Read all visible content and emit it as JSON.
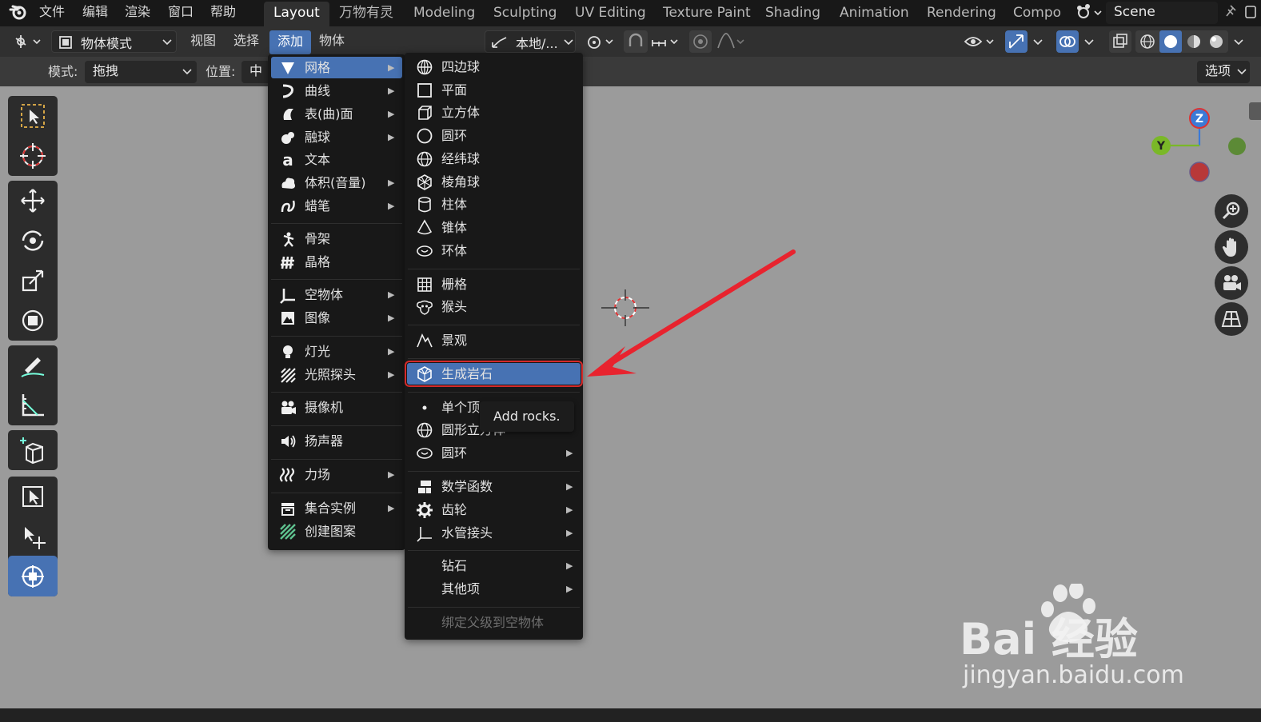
{
  "topbar": {
    "menus": [
      "文件",
      "编辑",
      "渲染",
      "窗口",
      "帮助"
    ],
    "workspaces": [
      "Layout",
      "万物有灵",
      "Modeling",
      "Sculpting",
      "UV Editing",
      "Texture Paint",
      "Shading",
      "Animation",
      "Rendering",
      "Compo"
    ],
    "active_workspace": "Layout",
    "scene": "Scene"
  },
  "header": {
    "mode": "物体模式",
    "menus": [
      "视图",
      "选择",
      "添加",
      "物体"
    ],
    "active_menu": "添加",
    "transform_orientation": "本地/..."
  },
  "toolsettings": {
    "mode_label": "模式:",
    "mode_value": "拖拽",
    "position_label": "位置:",
    "position_value": "中心",
    "options": "选项"
  },
  "add_menu": {
    "items": [
      {
        "label": "网格",
        "icon": "mesh-icon",
        "submenu": true,
        "highlighted": true
      },
      {
        "label": "曲线",
        "icon": "curve-icon",
        "submenu": true
      },
      {
        "label": "表(曲)面",
        "icon": "surface-icon",
        "submenu": true
      },
      {
        "label": "融球",
        "icon": "metaball-icon",
        "submenu": true
      },
      {
        "label": "文本",
        "icon": "text-icon",
        "submenu": false
      },
      {
        "label": "体积(音量)",
        "icon": "volume-icon",
        "submenu": true
      },
      {
        "label": "蜡笔",
        "icon": "grease-pencil-icon",
        "submenu": true
      },
      {
        "label": "骨架",
        "icon": "armature-icon",
        "submenu": false
      },
      {
        "label": "晶格",
        "icon": "lattice-icon",
        "submenu": false
      },
      {
        "label": "空物体",
        "icon": "empty-icon",
        "submenu": true
      },
      {
        "label": "图像",
        "icon": "image-icon",
        "submenu": true
      },
      {
        "label": "灯光",
        "icon": "light-icon",
        "submenu": true
      },
      {
        "label": "光照探头",
        "icon": "light-probe-icon",
        "submenu": true
      },
      {
        "label": "摄像机",
        "icon": "camera-icon",
        "submenu": false
      },
      {
        "label": "扬声器",
        "icon": "speaker-icon",
        "submenu": false
      },
      {
        "label": "力场",
        "icon": "force-field-icon",
        "submenu": true
      },
      {
        "label": "集合实例",
        "icon": "collection-icon",
        "submenu": true
      },
      {
        "label": "创建图案",
        "icon": "pattern-icon",
        "submenu": false
      }
    ]
  },
  "mesh_menu": {
    "items": [
      {
        "label": "四边球",
        "icon": "quad-sphere-icon"
      },
      {
        "label": "平面",
        "icon": "plane-icon"
      },
      {
        "label": "立方体",
        "icon": "cube-icon"
      },
      {
        "label": "圆环",
        "icon": "circle-icon"
      },
      {
        "label": "经纬球",
        "icon": "uv-sphere-icon"
      },
      {
        "label": "棱角球",
        "icon": "ico-sphere-icon"
      },
      {
        "label": "柱体",
        "icon": "cylinder-icon"
      },
      {
        "label": "锥体",
        "icon": "cone-icon"
      },
      {
        "label": "环体",
        "icon": "torus-icon"
      },
      {
        "label": "栅格",
        "icon": "grid-icon"
      },
      {
        "label": "猴头",
        "icon": "monkey-icon"
      },
      {
        "label": "景观",
        "icon": "landscape-icon"
      },
      {
        "label": "生成岩石",
        "icon": "rock-icon",
        "highlighted": true
      },
      {
        "label": "单个顶",
        "icon": "vertex-icon"
      },
      {
        "label": "圆形立方体",
        "icon": "round-cube-icon"
      },
      {
        "label": "圆环",
        "icon": "torus-obj-icon",
        "submenu": true
      },
      {
        "label": "数学函数",
        "icon": "math-function-icon",
        "submenu": true
      },
      {
        "label": "齿轮",
        "icon": "gear-icon",
        "submenu": true
      },
      {
        "label": "水管接头",
        "icon": "pipe-joint-icon",
        "submenu": true
      },
      {
        "label": "钻石",
        "icon": "",
        "submenu": true
      },
      {
        "label": "其他项",
        "icon": "",
        "submenu": true
      },
      {
        "label": "绑定父级到空物体",
        "icon": "",
        "disabled": true
      }
    ]
  },
  "tooltip": "Add rocks.",
  "watermark": {
    "logo_text": "Bai  经验",
    "url": "jingyan.baidu.com"
  },
  "gizmo": {
    "z": "Z",
    "y": "Y"
  },
  "colors": {
    "accent": "#4772b3",
    "arrow": "#e8232e",
    "highlight_outline": "#d42a2a"
  }
}
